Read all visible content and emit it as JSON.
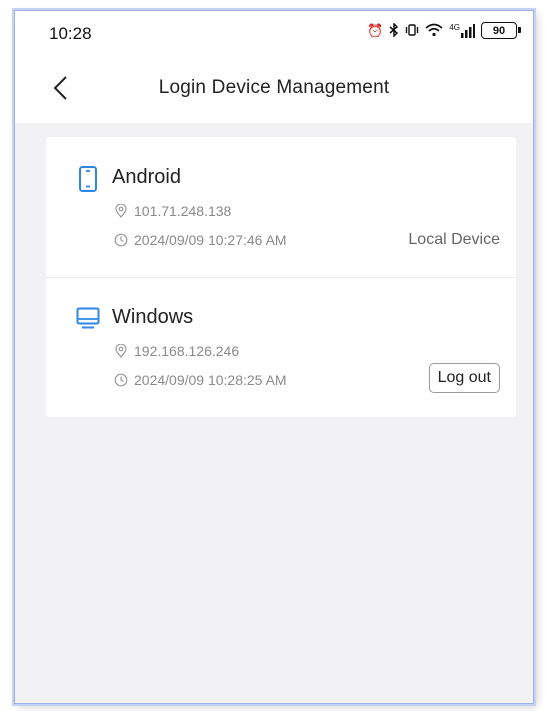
{
  "status_bar": {
    "time": "10:28",
    "network": "4G",
    "battery": "90"
  },
  "header": {
    "title": "Login Device Management"
  },
  "devices": [
    {
      "name": "Android",
      "icon": "phone-icon",
      "ip": "101.71.248.138",
      "login_time": "2024/09/09 10:27:46 AM",
      "status_label": "Local Device"
    },
    {
      "name": "Windows",
      "icon": "monitor-icon",
      "ip": "192.168.126.246",
      "login_time": "2024/09/09 10:28:25 AM",
      "action_label": "Log out"
    }
  ],
  "colors": {
    "accent": "#2f86e8",
    "background": "#f2f2f4",
    "meta_text": "#8a8a8a"
  }
}
